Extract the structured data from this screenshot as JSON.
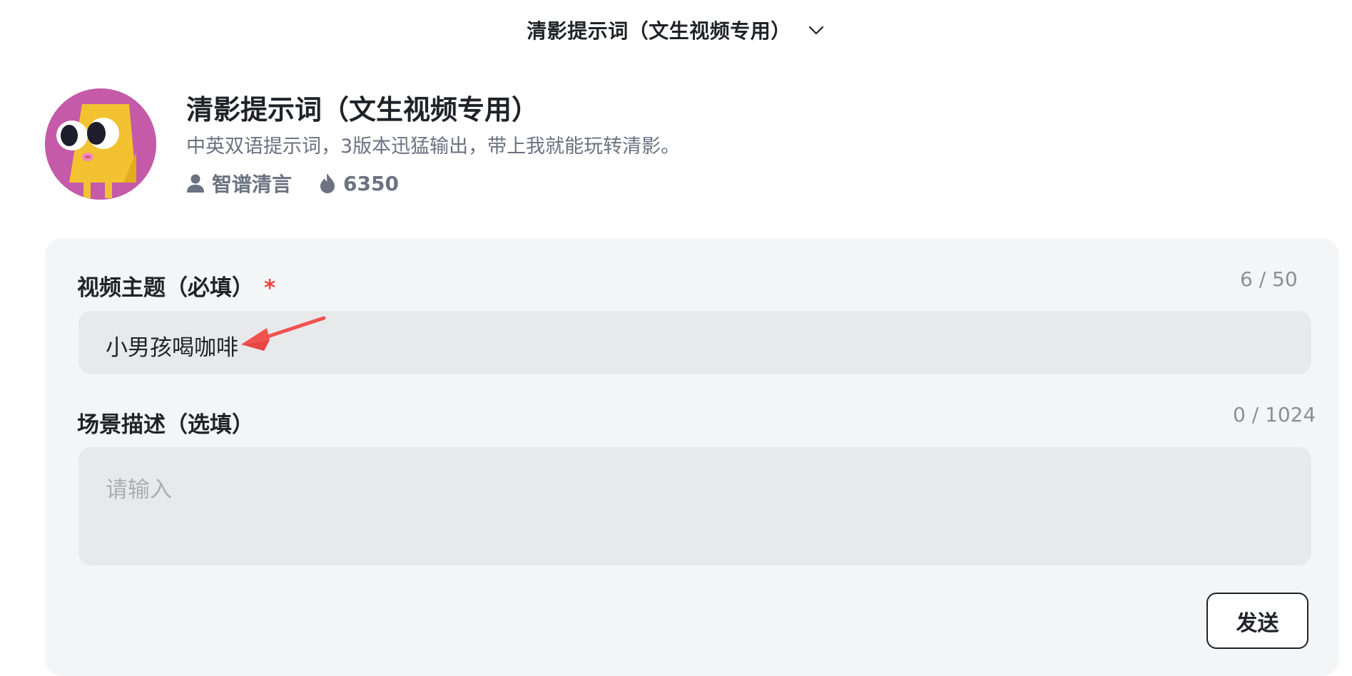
{
  "topbar": {
    "title": "清影提示词（文生视频专用）"
  },
  "agent": {
    "name": "清影提示词（文生视频专用）",
    "description": "中英双语提示词，3版本迅猛输出，带上我就能玩转清影。",
    "author": "智谱清言",
    "heat": "6350"
  },
  "form": {
    "topic": {
      "label": "视频主题（必填）",
      "required_mark": "*",
      "value": "小男孩喝咖啡",
      "counter": "6 / 50"
    },
    "scene": {
      "label": "场景描述（选填）",
      "placeholder": "请输入",
      "counter": "0 / 1024"
    },
    "send_label": "发送"
  },
  "icons": {
    "dropdown": "chevron-down-icon",
    "author": "user-icon",
    "heat": "flame-icon",
    "annotation": "red-arrow-annotation"
  },
  "colors": {
    "accent_required": "#ef4444",
    "panel_bg": "#f4f5f7",
    "input_bg": "#e8e9eb",
    "avatar_bg": "#c45aa8",
    "annotation_arrow": "#f0524f"
  }
}
